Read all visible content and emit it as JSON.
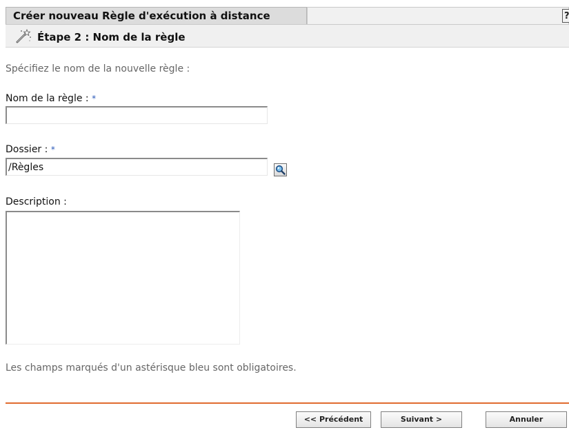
{
  "dialog": {
    "title": "Créer nouveau Règle d'exécution à distance",
    "help_label": "?"
  },
  "step": {
    "title": "Étape 2 : Nom de la règle",
    "icon": "wizard-wand-icon"
  },
  "form": {
    "intro": "Spécifiez le nom de la nouvelle règle :",
    "required_marker": "*",
    "rule_name": {
      "label": "Nom de la règle :",
      "value": ""
    },
    "folder": {
      "label": "Dossier :",
      "value": "/Règles",
      "browse_icon": "magnifier-browse-icon"
    },
    "description": {
      "label": "Description :",
      "value": ""
    },
    "footnote": "Les champs marqués d'un astérisque bleu sont obligatoires."
  },
  "buttons": {
    "previous": "<< Précédent",
    "next": "Suivant >",
    "cancel": "Annuler"
  },
  "colors": {
    "divider": "#e06a2e",
    "required_marker": "#2a58b8"
  }
}
